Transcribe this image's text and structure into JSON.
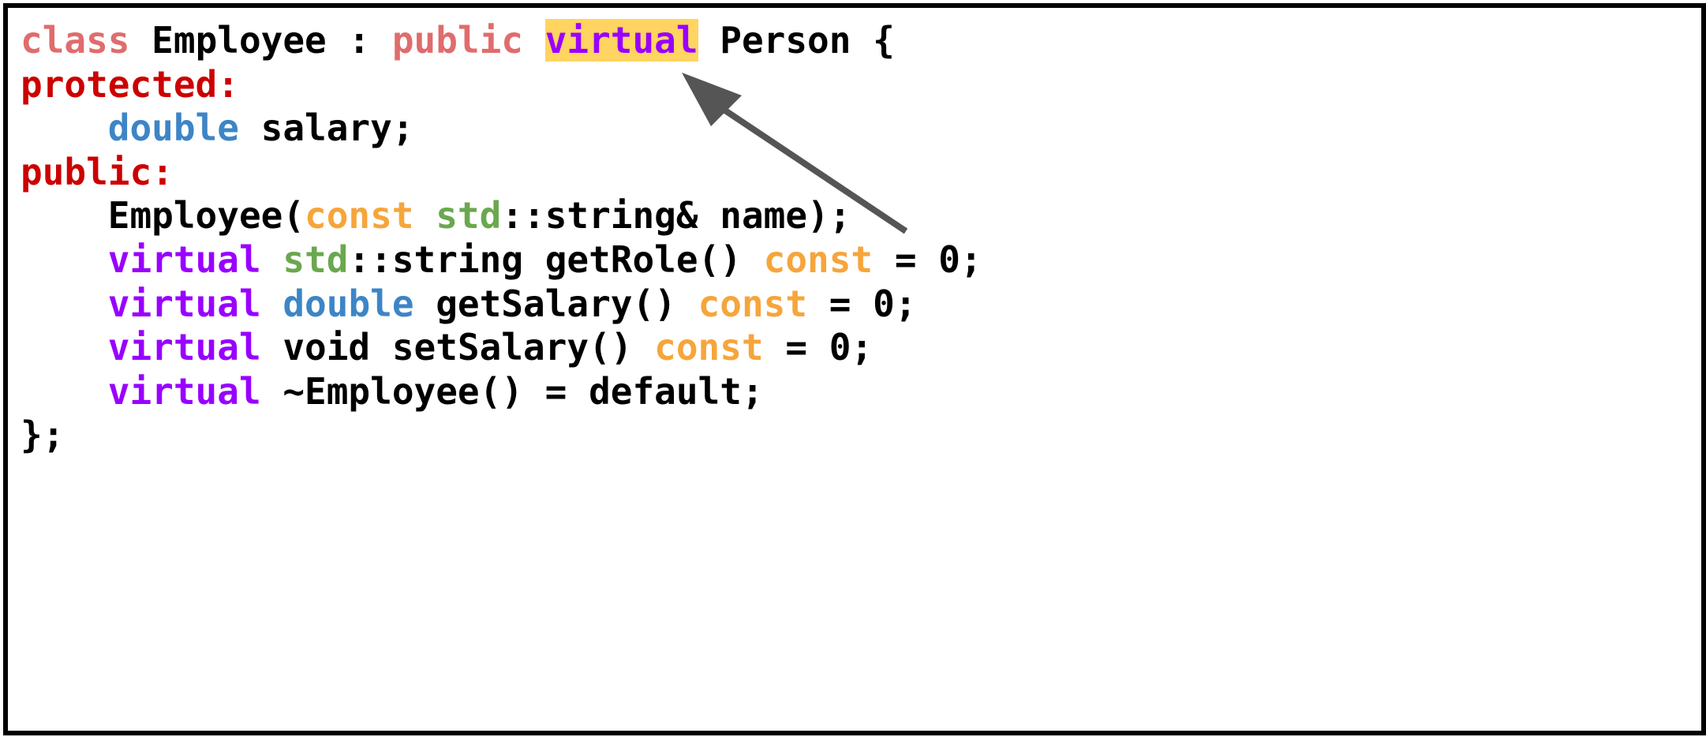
{
  "colors": {
    "kw_class": "#e06c6c",
    "kw_access": "#cc0000",
    "kw_virtual": "#9900ff",
    "kw_type": "#3d85c6",
    "kw_const": "#f6a53b",
    "kw_std": "#6aa84f",
    "plain": "#000000",
    "highlight_bg": "#ffd460",
    "arrow": "#555555"
  },
  "code_lines": [
    [
      {
        "text": "class",
        "color": "kw_class"
      },
      {
        "text": " Employee : ",
        "color": "plain"
      },
      {
        "text": "public",
        "color": "kw_class"
      },
      {
        "text": " ",
        "color": "plain"
      },
      {
        "text": "virtual",
        "color": "kw_virtual",
        "highlight": true
      },
      {
        "text": " Person {",
        "color": "plain"
      }
    ],
    [
      {
        "text": "protected:",
        "color": "kw_access"
      }
    ],
    [
      {
        "text": "    ",
        "color": "plain"
      },
      {
        "text": "double",
        "color": "kw_type"
      },
      {
        "text": " salary;",
        "color": "plain"
      }
    ],
    [
      {
        "text": "public:",
        "color": "kw_access"
      }
    ],
    [
      {
        "text": "    Employee(",
        "color": "plain"
      },
      {
        "text": "const",
        "color": "kw_const"
      },
      {
        "text": " ",
        "color": "plain"
      },
      {
        "text": "std",
        "color": "kw_std"
      },
      {
        "text": "::string& name);",
        "color": "plain"
      }
    ],
    [
      {
        "text": "    ",
        "color": "plain"
      },
      {
        "text": "virtual",
        "color": "kw_virtual"
      },
      {
        "text": " ",
        "color": "plain"
      },
      {
        "text": "std",
        "color": "kw_std"
      },
      {
        "text": "::string getRole() ",
        "color": "plain"
      },
      {
        "text": "const",
        "color": "kw_const"
      },
      {
        "text": " = 0;",
        "color": "plain"
      }
    ],
    [
      {
        "text": "    ",
        "color": "plain"
      },
      {
        "text": "virtual",
        "color": "kw_virtual"
      },
      {
        "text": " ",
        "color": "plain"
      },
      {
        "text": "double",
        "color": "kw_type"
      },
      {
        "text": " getSalary() ",
        "color": "plain"
      },
      {
        "text": "const",
        "color": "kw_const"
      },
      {
        "text": " = 0;",
        "color": "plain"
      }
    ],
    [
      {
        "text": "    ",
        "color": "plain"
      },
      {
        "text": "virtual",
        "color": "kw_virtual"
      },
      {
        "text": " void setSalary() ",
        "color": "plain"
      },
      {
        "text": "const",
        "color": "kw_const"
      },
      {
        "text": " = 0;",
        "color": "plain"
      }
    ],
    [
      {
        "text": "    ",
        "color": "plain"
      },
      {
        "text": "virtual",
        "color": "kw_virtual"
      },
      {
        "text": " ~Employee() = default;",
        "color": "plain"
      }
    ],
    [
      {
        "text": "};",
        "color": "plain"
      }
    ]
  ]
}
